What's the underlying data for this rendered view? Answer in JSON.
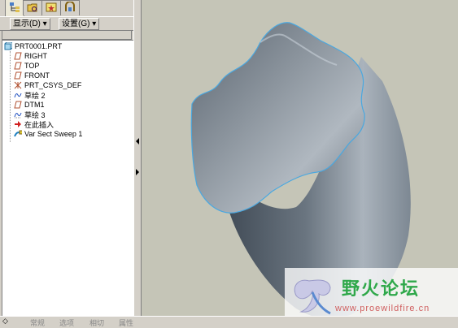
{
  "tabs": [
    {
      "icon": "model-tree-icon"
    },
    {
      "icon": "folder-browser-icon"
    },
    {
      "icon": "favorites-icon"
    },
    {
      "icon": "connections-icon"
    }
  ],
  "toolbar": {
    "show_label": "显示(D) ▾",
    "settings_label": "设置(G) ▾"
  },
  "tree": {
    "root": "PRT0001.PRT",
    "items": [
      {
        "label": "RIGHT",
        "icon": "datum-plane-icon"
      },
      {
        "label": "TOP",
        "icon": "datum-plane-icon"
      },
      {
        "label": "FRONT",
        "icon": "datum-plane-icon"
      },
      {
        "label": "PRT_CSYS_DEF",
        "icon": "csys-icon"
      },
      {
        "label": "草绘 2",
        "icon": "sketch-icon"
      },
      {
        "label": "DTM1",
        "icon": "datum-plane-icon"
      },
      {
        "label": "草绘 3",
        "icon": "sketch-icon"
      },
      {
        "label": "在此插入",
        "icon": "insert-here-arrow-icon"
      },
      {
        "label": "Var Sect Sweep 1",
        "icon": "var-sect-sweep-icon"
      }
    ]
  },
  "watermark": {
    "title": "野火论坛",
    "url": "www.proewildfire.cn"
  },
  "bottom_tabs": [
    "常规",
    "选项",
    "相切",
    "属性"
  ],
  "colors": {
    "panel": "#d4d0c8",
    "viewport_bg": "#c5c5b7",
    "surface_dark": "#3f4954",
    "surface_light": "#9aa3ac",
    "edge_highlight": "#4aa8e0",
    "watermark_green": "#2fa84a"
  }
}
